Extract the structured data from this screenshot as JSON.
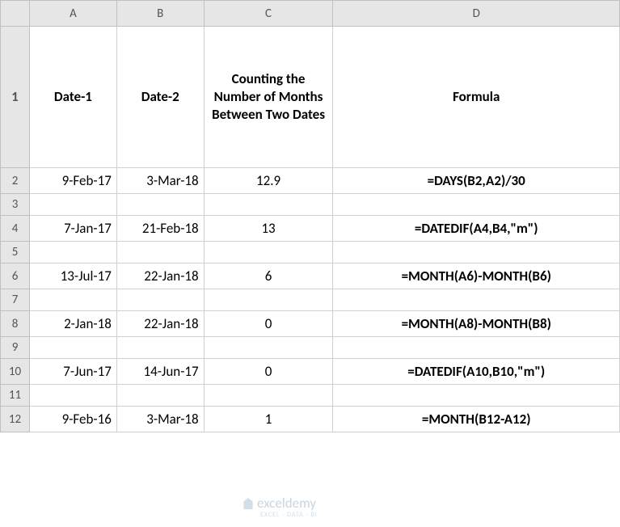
{
  "columns": [
    "A",
    "B",
    "C",
    "D"
  ],
  "headers": {
    "a": "Date-1",
    "b": "Date-2",
    "c": "Counting the Number of Months Between Two Dates",
    "d": "Formula"
  },
  "rows": [
    {
      "num": "1",
      "a": "",
      "b": "",
      "c": "",
      "d": "",
      "isHeader": true
    },
    {
      "num": "2",
      "a": "9-Feb-17",
      "b": "3-Mar-18",
      "c": "12.9",
      "d": "=DAYS(B2,A2)/30"
    },
    {
      "num": "3",
      "a": "",
      "b": "",
      "c": "",
      "d": "",
      "isEmpty": true
    },
    {
      "num": "4",
      "a": "7-Jan-17",
      "b": "21-Feb-18",
      "c": "13",
      "d": "=DATEDIF(A4,B4,\"m\")"
    },
    {
      "num": "5",
      "a": "",
      "b": "",
      "c": "",
      "d": "",
      "isEmpty": true
    },
    {
      "num": "6",
      "a": "13-Jul-17",
      "b": "22-Jan-18",
      "c": "6",
      "d": "=MONTH(A6)-MONTH(B6)"
    },
    {
      "num": "7",
      "a": "",
      "b": "",
      "c": "",
      "d": "",
      "isEmpty": true
    },
    {
      "num": "8",
      "a": "2-Jan-18",
      "b": "22-Jan-18",
      "c": "0",
      "d": "=MONTH(A8)-MONTH(B8)"
    },
    {
      "num": "9",
      "a": "",
      "b": "",
      "c": "",
      "d": "",
      "isEmpty": true
    },
    {
      "num": "10",
      "a": "7-Jun-17",
      "b": "14-Jun-17",
      "c": "0",
      "d": "=DATEDIF(A10,B10,\"m\")"
    },
    {
      "num": "11",
      "a": "",
      "b": "",
      "c": "",
      "d": "",
      "isEmpty": true
    },
    {
      "num": "12",
      "a": "9-Feb-16",
      "b": "3-Mar-18",
      "c": "1",
      "d": "=MONTH(B12-A12)"
    }
  ],
  "watermark": {
    "text": "exceldemy",
    "sub": "EXCEL · DATA · BI"
  },
  "chart_data": {
    "type": "table",
    "title": "Counting the Number of Months Between Two Dates",
    "columns": [
      "Date-1",
      "Date-2",
      "Counting the Number of Months Between Two Dates",
      "Formula"
    ],
    "data": [
      [
        "9-Feb-17",
        "3-Mar-18",
        12.9,
        "=DAYS(B2,A2)/30"
      ],
      [
        "7-Jan-17",
        "21-Feb-18",
        13,
        "=DATEDIF(A4,B4,\"m\")"
      ],
      [
        "13-Jul-17",
        "22-Jan-18",
        6,
        "=MONTH(A6)-MONTH(B6)"
      ],
      [
        "2-Jan-18",
        "22-Jan-18",
        0,
        "=MONTH(A8)-MONTH(B8)"
      ],
      [
        "7-Jun-17",
        "14-Jun-17",
        0,
        "=DATEDIF(A10,B10,\"m\")"
      ],
      [
        "9-Feb-16",
        "3-Mar-18",
        1,
        "=MONTH(B12-A12)"
      ]
    ]
  }
}
